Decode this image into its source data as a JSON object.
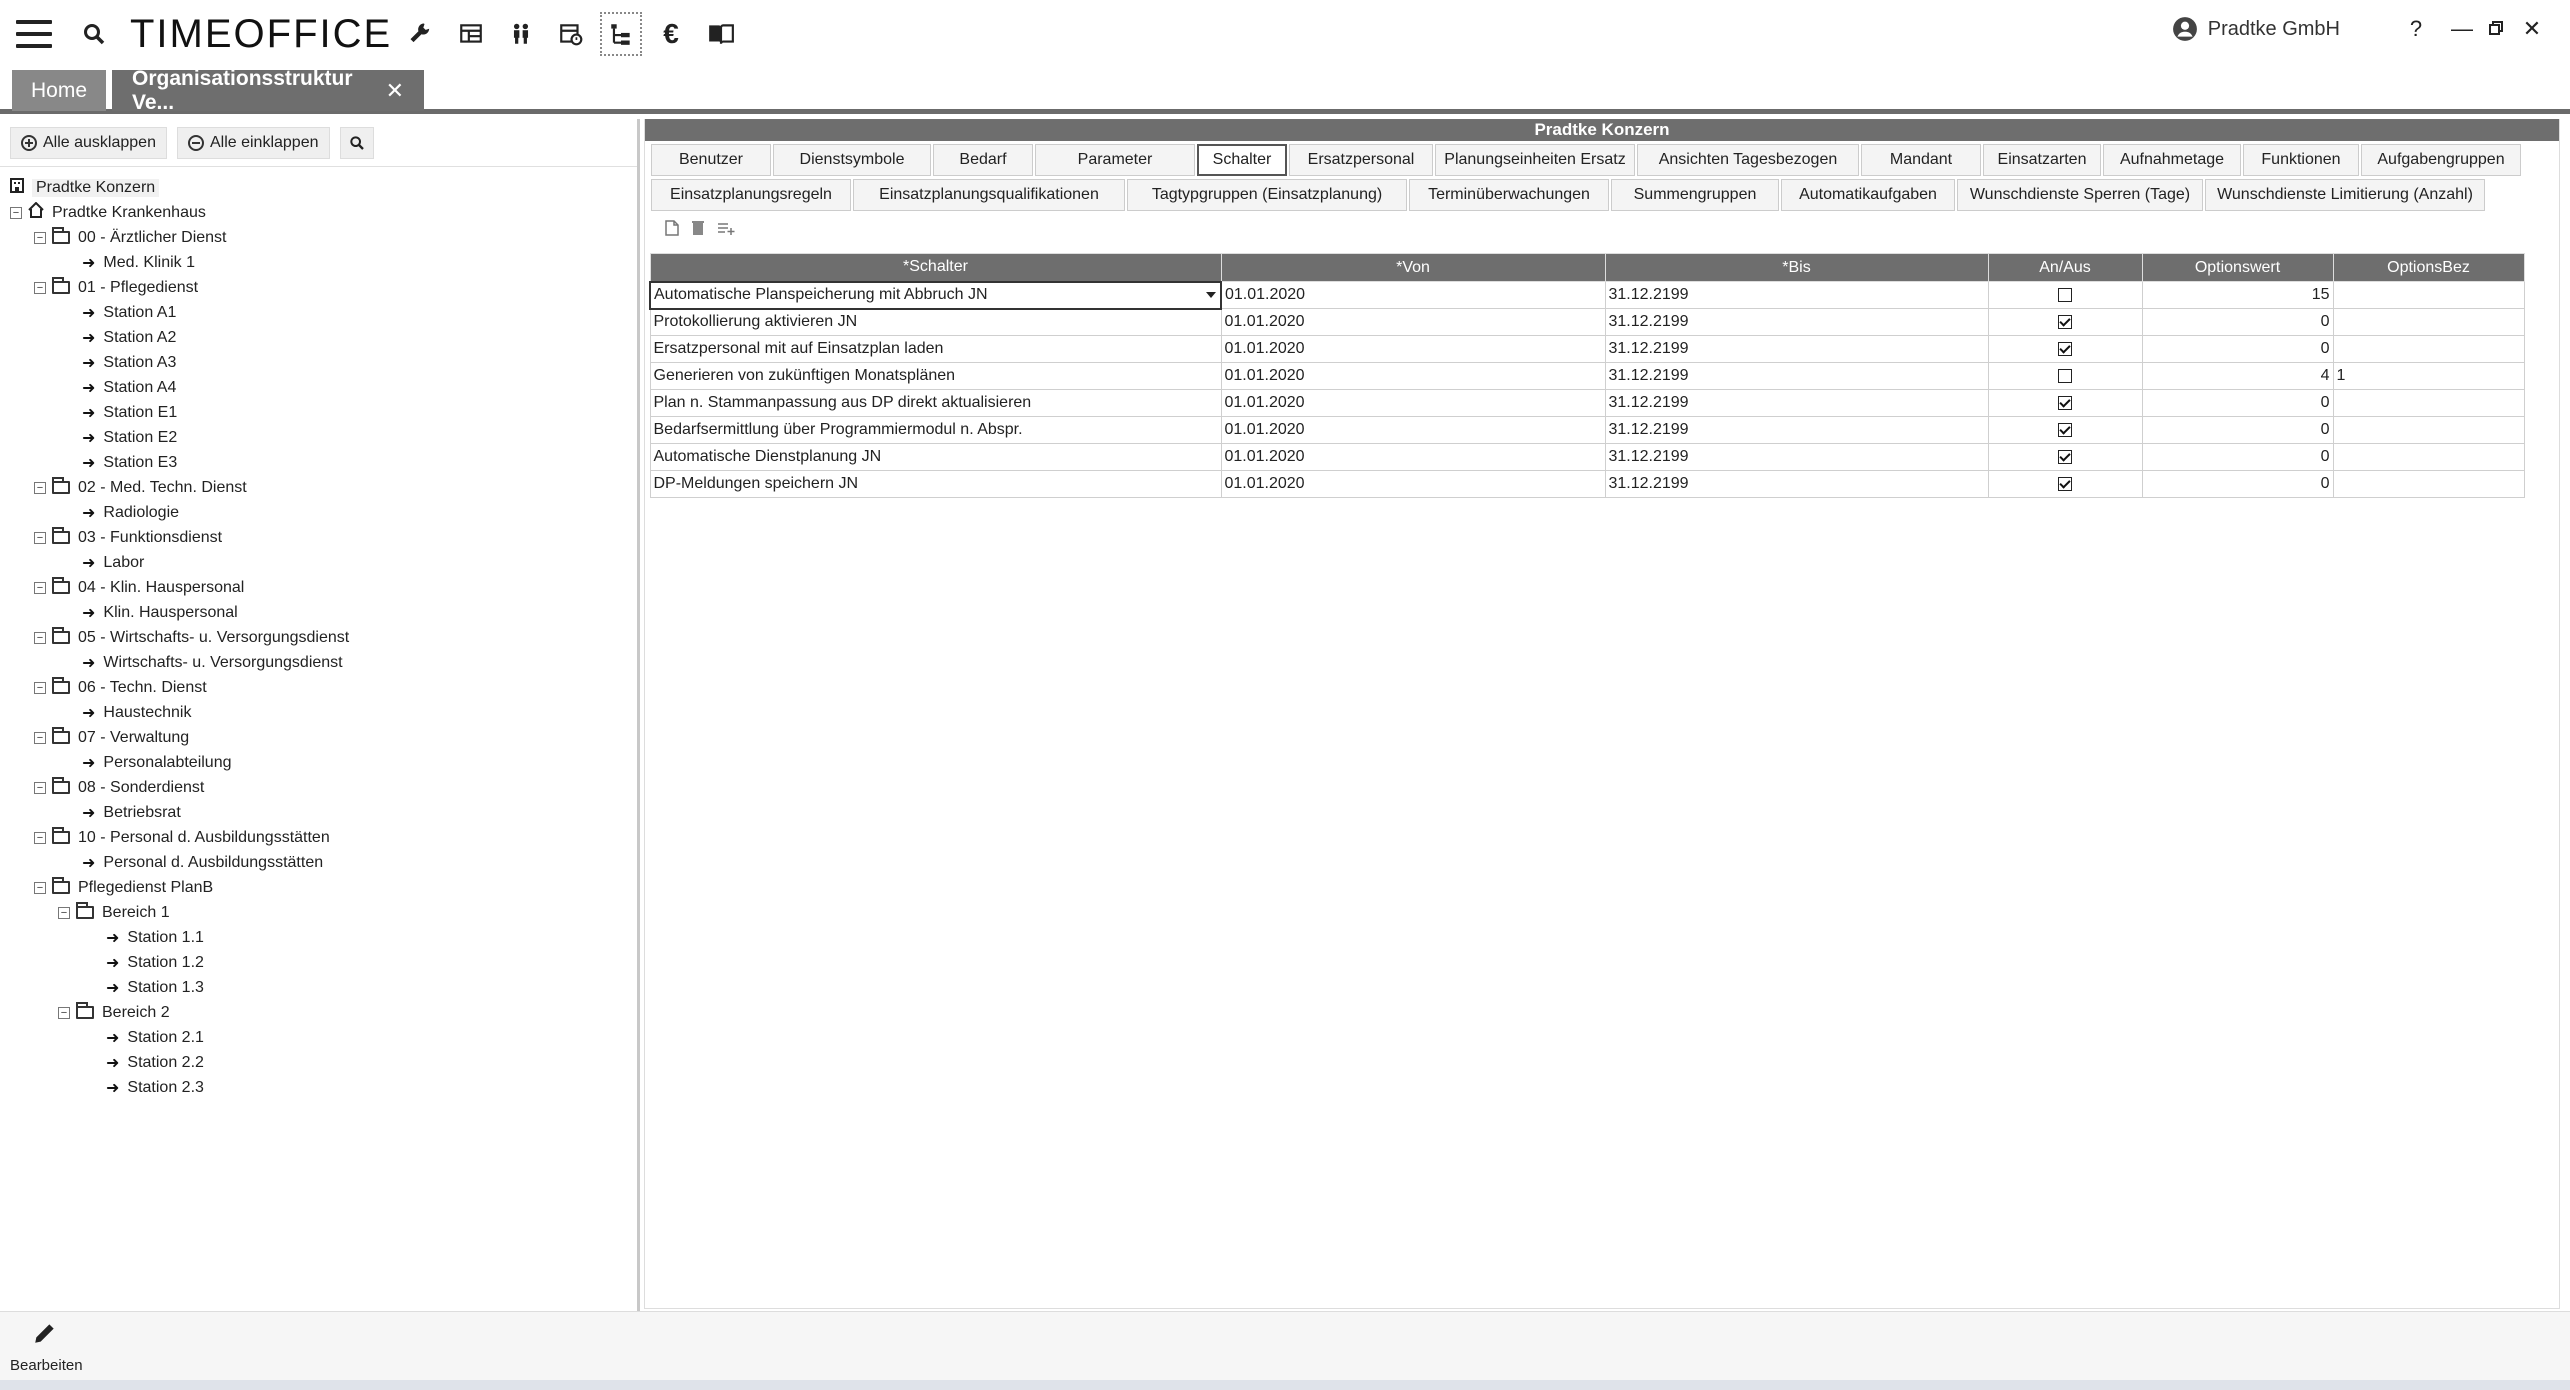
{
  "app": {
    "logo": "TIMEOFFICE",
    "user": "Pradtke GmbH",
    "help": "?",
    "toolbar_icons": [
      "wrench-icon",
      "table-icon",
      "people-icon",
      "calendar-table-icon",
      "org-tree-icon",
      "euro-icon",
      "book-icon"
    ]
  },
  "tabs": [
    {
      "label": "Home"
    },
    {
      "label": "Organisationsstruktur Ve...",
      "close": "✕"
    }
  ],
  "left": {
    "expand_all": "Alle ausklappen",
    "collapse_all": "Alle einklappen",
    "tree": [
      {
        "label": "Pradtke Konzern",
        "level": 0,
        "type": "root"
      },
      {
        "label": "Pradtke Krankenhaus",
        "level": 0,
        "type": "home"
      },
      {
        "label": "00 - Ärztlicher Dienst",
        "level": 1,
        "type": "folder"
      },
      {
        "label": "Med. Klinik 1",
        "level": 2,
        "type": "leaf"
      },
      {
        "label": "01 - Pflegedienst",
        "level": 1,
        "type": "folder"
      },
      {
        "label": "Station A1",
        "level": 2,
        "type": "leaf"
      },
      {
        "label": "Station A2",
        "level": 2,
        "type": "leaf"
      },
      {
        "label": "Station A3",
        "level": 2,
        "type": "leaf"
      },
      {
        "label": "Station A4",
        "level": 2,
        "type": "leaf"
      },
      {
        "label": "Station E1",
        "level": 2,
        "type": "leaf"
      },
      {
        "label": "Station E2",
        "level": 2,
        "type": "leaf"
      },
      {
        "label": "Station E3",
        "level": 2,
        "type": "leaf"
      },
      {
        "label": "02 - Med. Techn. Dienst",
        "level": 1,
        "type": "folder"
      },
      {
        "label": "Radiologie",
        "level": 2,
        "type": "leaf"
      },
      {
        "label": "03 - Funktionsdienst",
        "level": 1,
        "type": "folder"
      },
      {
        "label": "Labor",
        "level": 2,
        "type": "leaf"
      },
      {
        "label": "04 - Klin. Hauspersonal",
        "level": 1,
        "type": "folder"
      },
      {
        "label": "Klin. Hauspersonal",
        "level": 2,
        "type": "leaf"
      },
      {
        "label": "05 - Wirtschafts- u. Versorgungsdienst",
        "level": 1,
        "type": "folder"
      },
      {
        "label": "Wirtschafts- u. Versorgungsdienst",
        "level": 2,
        "type": "leaf"
      },
      {
        "label": "06 - Techn. Dienst",
        "level": 1,
        "type": "folder"
      },
      {
        "label": "Haustechnik",
        "level": 2,
        "type": "leaf"
      },
      {
        "label": "07 - Verwaltung",
        "level": 1,
        "type": "folder"
      },
      {
        "label": "Personalabteilung",
        "level": 2,
        "type": "leaf"
      },
      {
        "label": "08 - Sonderdienst",
        "level": 1,
        "type": "folder"
      },
      {
        "label": "Betriebsrat",
        "level": 2,
        "type": "leaf"
      },
      {
        "label": "10 - Personal d. Ausbildungsstätten",
        "level": 1,
        "type": "folder"
      },
      {
        "label": "Personal d. Ausbildungsstätten",
        "level": 2,
        "type": "leaf"
      },
      {
        "label": "Pflegedienst PlanB",
        "level": 1,
        "type": "folder"
      },
      {
        "label": "Bereich 1",
        "level": 2,
        "type": "folder"
      },
      {
        "label": "Station 1.1",
        "level": 3,
        "type": "leaf"
      },
      {
        "label": "Station 1.2",
        "level": 3,
        "type": "leaf"
      },
      {
        "label": "Station 1.3",
        "level": 3,
        "type": "leaf"
      },
      {
        "label": "Bereich 2",
        "level": 2,
        "type": "folder"
      },
      {
        "label": "Station 2.1",
        "level": 3,
        "type": "leaf"
      },
      {
        "label": "Station 2.2",
        "level": 3,
        "type": "leaf"
      },
      {
        "label": "Station 2.3",
        "level": 3,
        "type": "leaf"
      }
    ]
  },
  "right": {
    "title": "Pradtke Konzern",
    "subtabs_row1": [
      "Benutzer",
      "Dienstsymbole",
      "Bedarf",
      "Parameter",
      "Schalter",
      "Ersatzpersonal",
      "Planungseinheiten Ersatz",
      "Ansichten Tagesbezogen",
      "Mandant",
      "Einsatzarten",
      "Aufnahmetage",
      "Funktionen",
      "Aufgabengruppen"
    ],
    "subtabs_row2": [
      "Einsatzplanungsregeln",
      "Einsatzplanungsqualifikationen",
      "Tagtypgruppen (Einsatzplanung)",
      "Terminüberwachungen",
      "Summengruppen",
      "Automatikaufgaben",
      "Wunschdienste Sperren (Tage)",
      "Wunschdienste Limitierung (Anzahl)"
    ],
    "active_subtab": "Schalter",
    "columns": [
      "*Schalter",
      "*Von",
      "*Bis",
      "An/Aus",
      "Optionswert",
      "OptionsBez"
    ],
    "rows": [
      {
        "schalter": "Automatische Planspeicherung mit Abbruch JN",
        "von": "01.01.2020",
        "bis": "31.12.2199",
        "an": false,
        "wert": "15",
        "bez": ""
      },
      {
        "schalter": "Protokollierung aktivieren JN",
        "von": "01.01.2020",
        "bis": "31.12.2199",
        "an": true,
        "wert": "0",
        "bez": ""
      },
      {
        "schalter": "Ersatzpersonal mit auf Einsatzplan laden",
        "von": "01.01.2020",
        "bis": "31.12.2199",
        "an": true,
        "wert": "0",
        "bez": ""
      },
      {
        "schalter": "Generieren von zukünftigen Monatsplänen",
        "von": "01.01.2020",
        "bis": "31.12.2199",
        "an": false,
        "wert": "4",
        "bez": "1"
      },
      {
        "schalter": "Plan n. Stammanpassung aus DP direkt aktualisieren",
        "von": "01.01.2020",
        "bis": "31.12.2199",
        "an": true,
        "wert": "0",
        "bez": ""
      },
      {
        "schalter": "Bedarfsermittlung über Programmiermodul n. Abspr.",
        "von": "01.01.2020",
        "bis": "31.12.2199",
        "an": true,
        "wert": "0",
        "bez": ""
      },
      {
        "schalter": "Automatische Dienstplanung JN",
        "von": "01.01.2020",
        "bis": "31.12.2199",
        "an": true,
        "wert": "0",
        "bez": ""
      },
      {
        "schalter": "DP-Meldungen speichern JN",
        "von": "01.01.2020",
        "bis": "31.12.2199",
        "an": true,
        "wert": "0",
        "bez": ""
      }
    ]
  },
  "bottom": {
    "edit_label": "Bearbeiten"
  }
}
